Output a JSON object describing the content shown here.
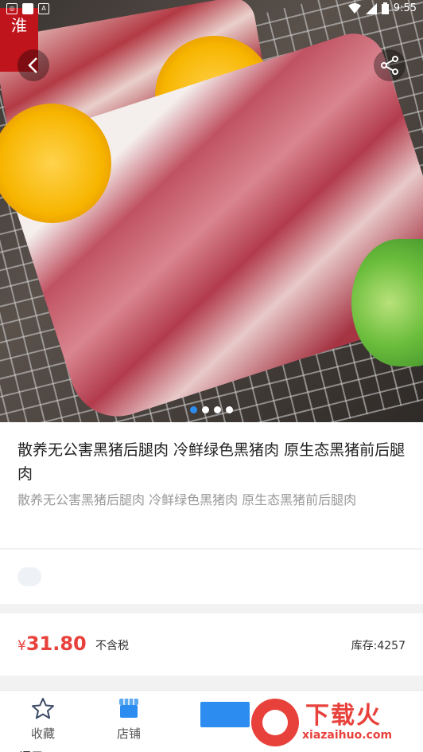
{
  "status_bar": {
    "time": "9:55",
    "left_icons": [
      "notification-icon",
      "square-icon",
      "app-icon"
    ],
    "right_icons": [
      "wifi-icon",
      "signal-icon",
      "battery-icon"
    ]
  },
  "hero": {
    "logo_text": "淮",
    "carousel": {
      "count": 4,
      "active_index": 0
    }
  },
  "product": {
    "title": "散养无公害黑猪后腿肉 冷鲜绿色黑猪肉 原生态黑猪前后腿肉",
    "subtitle": "散养无公害黑猪后腿肉 冷鲜绿色黑猪肉 原生态黑猪前后腿肉"
  },
  "pricing": {
    "currency_symbol": "¥",
    "price": "31.80",
    "tax_note": "不含税",
    "stock": "库存:4257"
  },
  "bottom_bar": {
    "favorite_label": "收藏",
    "shop_label": "店铺",
    "partial_text": "评用"
  },
  "watermark": {
    "text": "下载火",
    "url": "xiazaihuo.com"
  },
  "colors": {
    "accent_blue": "#2d8cf0",
    "price_red": "#e8413b"
  }
}
